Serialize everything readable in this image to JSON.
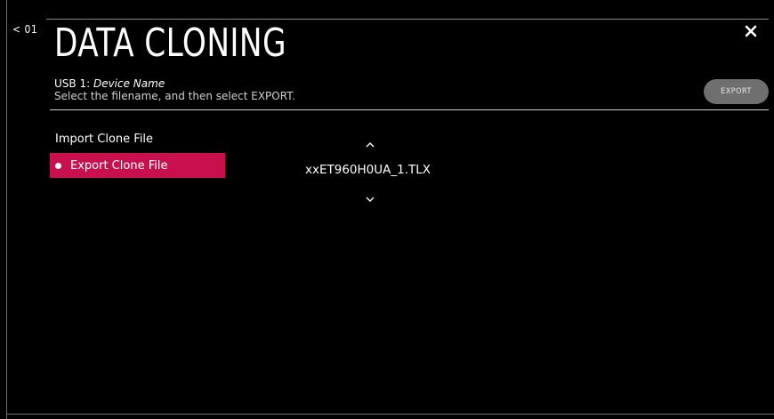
{
  "header": {
    "back_label": "< 01",
    "title": "DATA CLONING",
    "device_prefix": "USB 1: ",
    "device_name": "Device Name",
    "instruction": "Select the filename, and then select EXPORT.",
    "export_button_label": "EXPORT"
  },
  "menu": {
    "items": [
      {
        "label": "Import Clone File",
        "selected": false
      },
      {
        "label": "Export Clone File",
        "selected": true
      }
    ]
  },
  "file_list": {
    "current_file": "xxET960H0UA_1.TLX"
  },
  "colors": {
    "background": "#000000",
    "accent": "#c8104f",
    "export_button": "#6f6f6f",
    "rule": "#d0d0d0"
  },
  "icons": {
    "close": "close-icon",
    "up": "chevron-up-icon",
    "down": "chevron-down-icon",
    "selected_marker": "selected-dot-icon"
  }
}
